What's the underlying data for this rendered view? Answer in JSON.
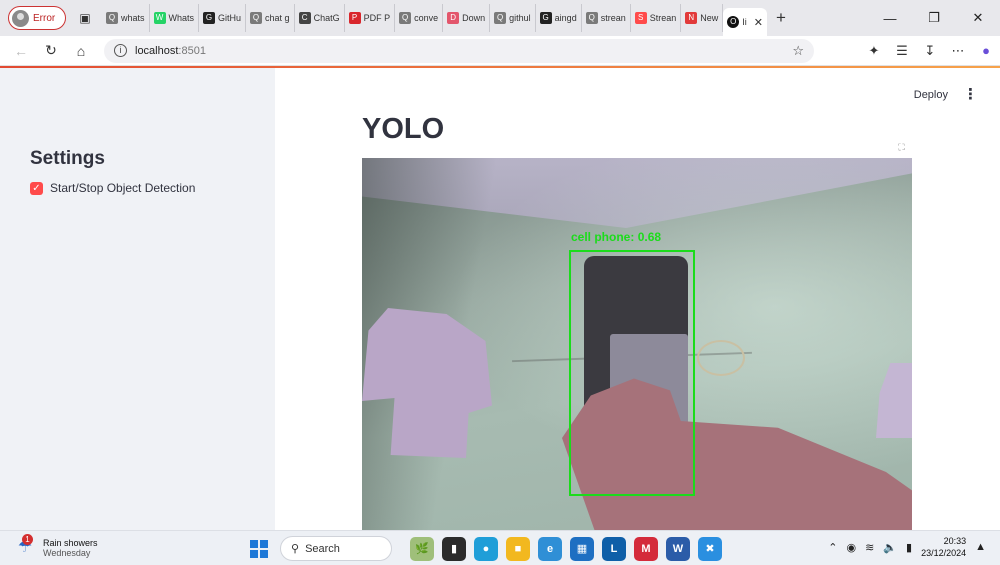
{
  "browser": {
    "profile_label": "Error",
    "tabs": [
      {
        "label": "whats",
        "fav": "Q",
        "color": "#7a7a7a"
      },
      {
        "label": "Whats",
        "fav": "W",
        "color": "#25d366"
      },
      {
        "label": "GitHu",
        "fav": "G",
        "color": "#222222"
      },
      {
        "label": "chat g",
        "fav": "Q",
        "color": "#7a7a7a"
      },
      {
        "label": "ChatG",
        "fav": "C",
        "color": "#444444"
      },
      {
        "label": "PDF P",
        "fav": "P",
        "color": "#d9262c"
      },
      {
        "label": "conve",
        "fav": "Q",
        "color": "#7a7a7a"
      },
      {
        "label": "Down",
        "fav": "D",
        "color": "#e3566c"
      },
      {
        "label": "githul",
        "fav": "Q",
        "color": "#7a7a7a"
      },
      {
        "label": "aingd",
        "fav": "G",
        "color": "#222222"
      },
      {
        "label": "strean",
        "fav": "Q",
        "color": "#7a7a7a"
      },
      {
        "label": "Strean",
        "fav": "S",
        "color": "#ff4b4b"
      },
      {
        "label": "New",
        "fav": "N",
        "color": "#e23a3a"
      }
    ],
    "active_tab": {
      "label": "Ii",
      "fav": "O",
      "color": "#111111"
    },
    "url_host": "localhost",
    "url_port": ":8501"
  },
  "sidebar": {
    "title": "Settings",
    "checkbox": {
      "label": "Start/Stop Object Detection",
      "checked": true
    }
  },
  "header": {
    "deploy_label": "Deploy"
  },
  "main": {
    "title": "YOLO"
  },
  "detection": {
    "label": "cell phone",
    "score": "0.68",
    "box_color": "#1bdc1b"
  },
  "taskbar": {
    "weather_title": "Rain showers",
    "weather_day": "Wednesday",
    "weather_badge": "1",
    "search_placeholder": "Search",
    "time": "20:33",
    "date": "23/12/2024"
  },
  "colors": {
    "accent": "#ff4b4b",
    "sidebar_bg": "#f0f2f6",
    "text": "#31333f"
  }
}
